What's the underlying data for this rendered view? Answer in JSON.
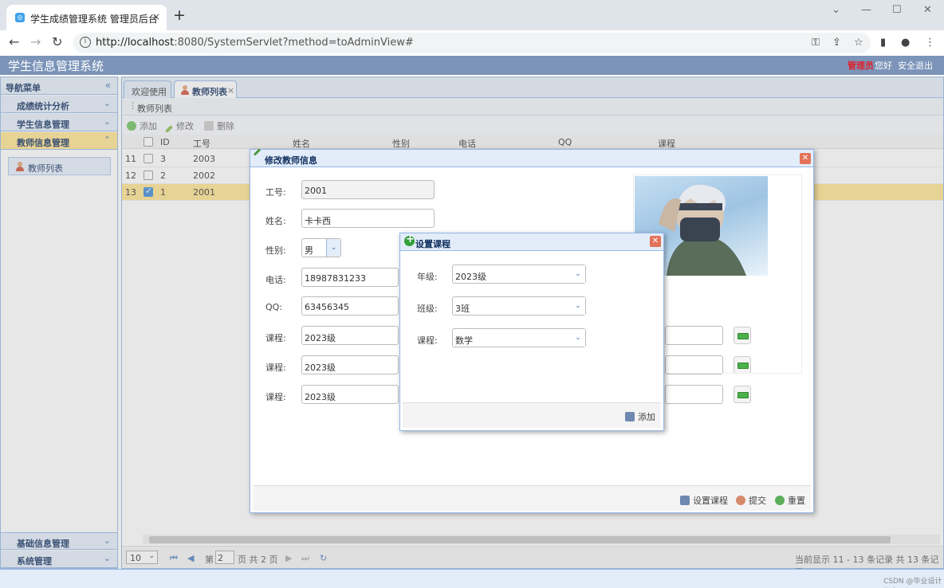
{
  "browser": {
    "tab_title": "学生成绩管理系统 管理员后台",
    "tab_close": "×",
    "new_tab": "+",
    "url_host": "http://localhost",
    "url_rest": ":8080/SystemServlet?method=toAdminView#"
  },
  "app": {
    "title": "学生信息管理系统",
    "role": "管理员",
    "greeting": "您好",
    "logout": "安全退出"
  },
  "sidebar": {
    "title": "导航菜单",
    "sections": [
      {
        "label": "成绩统计分析"
      },
      {
        "label": "学生信息管理"
      },
      {
        "label": "教师信息管理"
      }
    ],
    "link": "教师列表",
    "bottom_sections": [
      {
        "label": "基础信息管理"
      },
      {
        "label": "系统管理"
      }
    ]
  },
  "tabs": [
    {
      "label": "欢迎使用"
    },
    {
      "label": "教师列表",
      "close": "×"
    }
  ],
  "panel_title": "教师列表",
  "toolbar": {
    "add": "添加",
    "edit": "修改",
    "delete": "删除"
  },
  "grid": {
    "columns": [
      "ID",
      "工号",
      "姓名",
      "性别",
      "电话",
      "QQ",
      "课程"
    ],
    "rows": [
      {
        "num": "11",
        "id": "3",
        "no": "2003"
      },
      {
        "num": "12",
        "id": "2",
        "no": "2002"
      },
      {
        "num": "13",
        "id": "1",
        "no": "2001",
        "selected": true
      }
    ]
  },
  "pager": {
    "page_size": "10",
    "page_prefix": "第",
    "page_value": "2",
    "page_suffix": "页 共 2 页",
    "summary": "当前显示 11 - 13 条记录 共 13 条记录"
  },
  "watermark": "CSDN @毕业设计极客",
  "edit_dialog": {
    "title": "修改教师信息",
    "fields": {
      "no_label": "工号:",
      "no": "2001",
      "name_label": "姓名:",
      "name": "卡卡西",
      "gender_label": "性别:",
      "gender": "男",
      "phone_label": "电话:",
      "phone": "18987831233",
      "qq_label": "QQ:",
      "qq": "63456345"
    },
    "courses": [
      {
        "label": "课程:",
        "value": "2023级"
      },
      {
        "label": "课程:",
        "value": "2023级"
      },
      {
        "label": "课程:",
        "value": "2023级"
      }
    ],
    "footer": {
      "set_course": "设置课程",
      "submit": "提交",
      "reset": "重置"
    }
  },
  "course_dialog": {
    "title": "设置课程",
    "grade_label": "年级:",
    "grade": "2023级",
    "class_label": "班级:",
    "class": "3班",
    "course_label": "课程:",
    "course": "数学",
    "add": "添加"
  }
}
